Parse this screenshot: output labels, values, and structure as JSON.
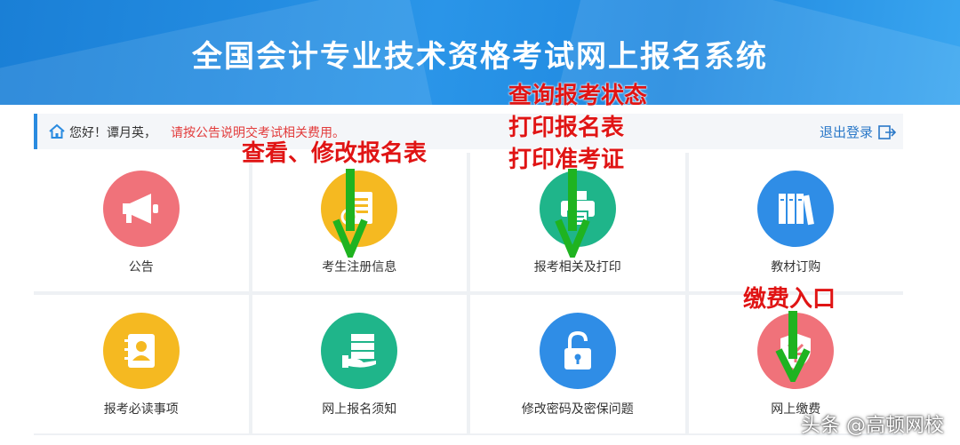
{
  "banner": {
    "title": "全国会计专业技术资格考试网上报名系统"
  },
  "greeting": {
    "text": "您好！谭月英，",
    "notice": "请按公告说明交考试相关费用。",
    "logout_label": "退出登录"
  },
  "tiles": [
    {
      "label": "公告",
      "icon": "megaphone-icon",
      "color": "#f0727a"
    },
    {
      "label": "考生注册信息",
      "icon": "registration-info-icon",
      "color": "#f5b921"
    },
    {
      "label": "报考相关及打印",
      "icon": "printer-icon",
      "color": "#1fb58a"
    },
    {
      "label": "教材订购",
      "icon": "books-icon",
      "color": "#2f8de6"
    },
    {
      "label": "报考必读事项",
      "icon": "contact-book-icon",
      "color": "#f5b921"
    },
    {
      "label": "网上报名须知",
      "icon": "server-hand-icon",
      "color": "#1fb58a"
    },
    {
      "label": "修改密码及密保问题",
      "icon": "lock-icon",
      "color": "#2f8de6"
    },
    {
      "label": "网上缴费",
      "icon": "payment-shield-icon",
      "color": "#f0727a"
    }
  ],
  "annotations": {
    "view_edit": "查看、修改报名表",
    "status_lines": [
      "查询报考状态",
      "打印报名表",
      "打印准考证"
    ],
    "payment": "缴费入口"
  },
  "watermark": "头条 @高顿网校"
}
